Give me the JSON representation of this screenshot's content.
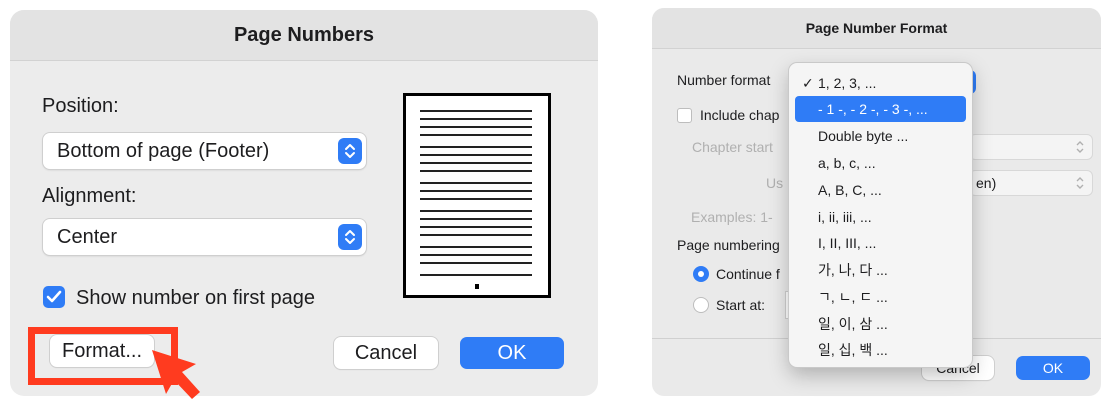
{
  "page_numbers": {
    "title": "Page Numbers",
    "position_label": "Position:",
    "position_value": "Bottom of page (Footer)",
    "alignment_label": "Alignment:",
    "alignment_value": "Center",
    "show_first_page_label": "Show number on first page",
    "show_first_page_checked": true,
    "format_button": "Format...",
    "cancel_button": "Cancel",
    "ok_button": "OK"
  },
  "page_number_format": {
    "title": "Page Number Format",
    "number_format_label": "Number format",
    "include_chapter_label": "Include chap",
    "chapter_starts_label": "Chapter start",
    "use_label": "Us",
    "use_value_suffix": "en)",
    "examples_label": "Examples: 1-",
    "page_numbering_label": "Page numbering",
    "continue_label": "Continue f",
    "start_at_label": "Start at:",
    "cancel_button": "Cancel",
    "ok_button": "OK",
    "menu": {
      "selected_index": 1,
      "check_glyph": "✓",
      "items": [
        "1, 2, 3, ...",
        "- 1 -, - 2 -, - 3 -, ...",
        "Double byte ...",
        "a, b, c, ...",
        "A, B, C, ...",
        "i, ii, iii, ...",
        "I, II, III, ...",
        "가, 나, 다 ...",
        "ㄱ, ㄴ, ㄷ ...",
        "일, 이, 삼 ...",
        "일, 십, 백 ..."
      ]
    }
  },
  "colors": {
    "accent": "#2f7cf6",
    "annotation": "#ff3b1f"
  }
}
